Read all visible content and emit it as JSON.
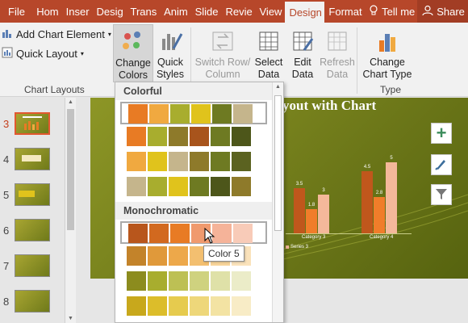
{
  "tabs": [
    "File",
    "Hom",
    "Inser",
    "Desig",
    "Trans",
    "Anim",
    "Slide",
    "Revie",
    "View",
    "Design",
    "Format",
    "Tell me",
    "Share"
  ],
  "ribbon": {
    "add_chart_element": "Add Chart Element",
    "quick_layout": "Quick Layout",
    "change_colors": [
      "Change",
      "Colors"
    ],
    "quick_styles": [
      "Quick",
      "Styles"
    ],
    "switch_row_column": [
      "Switch Row/",
      "Column"
    ],
    "select_data": [
      "Select",
      "Data"
    ],
    "edit_data": [
      "Edit",
      "Data"
    ],
    "refresh_data": [
      "Refresh",
      "Data"
    ],
    "change_chart_type": [
      "Change",
      "Chart Type"
    ],
    "group_chart_layouts": "Chart Layouts",
    "group_type": "Type"
  },
  "thumbnails": [
    {
      "num": "3",
      "selected": true
    },
    {
      "num": "4",
      "selected": false
    },
    {
      "num": "5",
      "selected": false
    },
    {
      "num": "6",
      "selected": false
    },
    {
      "num": "7",
      "selected": false
    },
    {
      "num": "8",
      "selected": false
    }
  ],
  "slide": {
    "title": "yout with Chart",
    "data_labels": [
      "3.5",
      "1.8",
      "3",
      "4.5",
      "2.8",
      "5"
    ],
    "categories": [
      "Category 3",
      "Category 4"
    ],
    "legend_fragment": "Series 3"
  },
  "dropdown": {
    "section_colorful": "Colorful",
    "section_monochromatic": "Monochromatic",
    "colorful_rows": [
      [
        "#e87b24",
        "#f0a940",
        "#a8ad2e",
        "#e0c31c",
        "#6e7a22",
        "#c5b58c"
      ],
      [
        "#e87b24",
        "#a8ad2e",
        "#8e7a2a",
        "#a8541c",
        "#6e7a22",
        "#4d561a"
      ],
      [
        "#f0a940",
        "#e0c31c",
        "#c5b58c",
        "#8e7a2a",
        "#6e7a22",
        "#5b6220"
      ],
      [
        "#c5b58c",
        "#a8ad2e",
        "#e0c31c",
        "#6e7a22",
        "#4d561a",
        "#8e7a2a"
      ]
    ],
    "mono_rows": [
      [
        "#b8561c",
        "#d2691f",
        "#e87b24",
        "#f09a6e",
        "#f5b399",
        "#f8cbb8"
      ],
      [
        "#c3832a",
        "#e0993a",
        "#eda84a",
        "#f3bf70",
        "#f7d49a",
        "#fae2bb"
      ],
      [
        "#8c8c1e",
        "#a8ad2e",
        "#bdc054",
        "#cfd27f",
        "#dfe1a8",
        "#ebecc8"
      ],
      [
        "#c8a81c",
        "#dcbd2a",
        "#e6cb4e",
        "#eed77a",
        "#f3e3a3",
        "#f8ecc6"
      ]
    ],
    "tooltip": "Color 5"
  }
}
